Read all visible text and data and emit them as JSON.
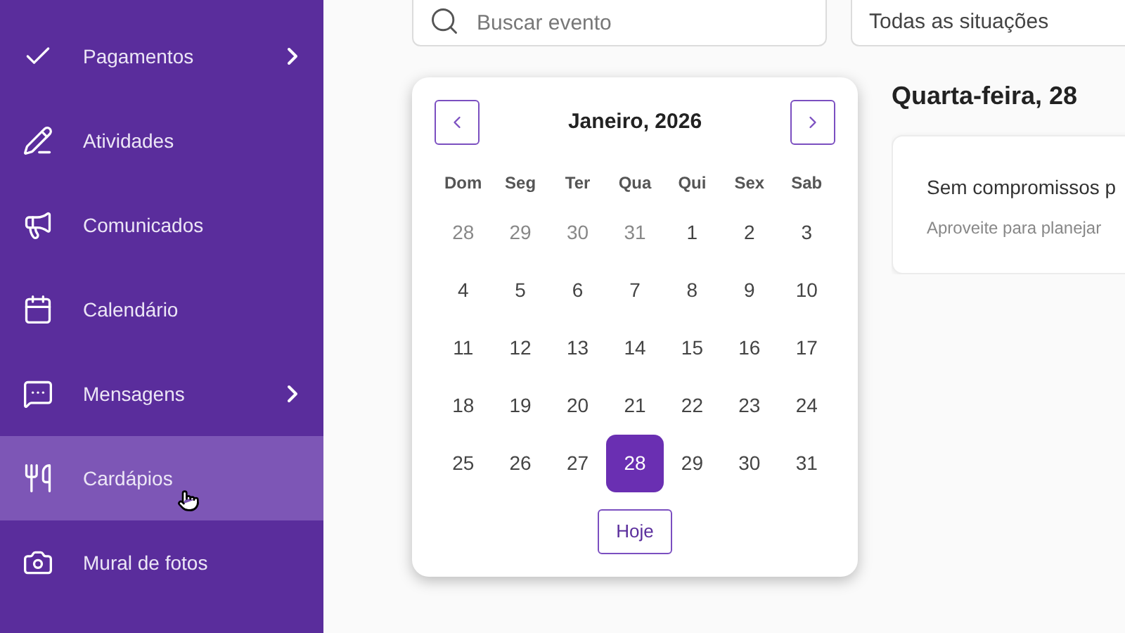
{
  "sidebar": {
    "items": [
      {
        "label": "Pagamentos",
        "has_submenu": true,
        "hovered": false
      },
      {
        "label": "Atividades",
        "has_submenu": false,
        "hovered": false
      },
      {
        "label": "Comunicados",
        "has_submenu": false,
        "hovered": false
      },
      {
        "label": "Calendário",
        "has_submenu": false,
        "hovered": false
      },
      {
        "label": "Mensagens",
        "has_submenu": true,
        "hovered": false
      },
      {
        "label": "Cardápios",
        "has_submenu": false,
        "hovered": true
      },
      {
        "label": "Mural de fotos",
        "has_submenu": false,
        "hovered": false
      }
    ]
  },
  "search": {
    "placeholder": "Buscar evento"
  },
  "status_filter": {
    "value": "Todas as situações"
  },
  "calendar": {
    "month": "Janeiro, 2026",
    "weekdays": [
      "Dom",
      "Seg",
      "Ter",
      "Qua",
      "Qui",
      "Sex",
      "Sab"
    ],
    "days": [
      {
        "label": "28",
        "muted": true,
        "selected": false
      },
      {
        "label": "29",
        "muted": true,
        "selected": false
      },
      {
        "label": "30",
        "muted": true,
        "selected": false
      },
      {
        "label": "31",
        "muted": true,
        "selected": false
      },
      {
        "label": "1",
        "muted": false,
        "selected": false
      },
      {
        "label": "2",
        "muted": false,
        "selected": false
      },
      {
        "label": "3",
        "muted": false,
        "selected": false
      },
      {
        "label": "4",
        "muted": false,
        "selected": false
      },
      {
        "label": "5",
        "muted": false,
        "selected": false
      },
      {
        "label": "6",
        "muted": false,
        "selected": false
      },
      {
        "label": "7",
        "muted": false,
        "selected": false
      },
      {
        "label": "8",
        "muted": false,
        "selected": false
      },
      {
        "label": "9",
        "muted": false,
        "selected": false
      },
      {
        "label": "10",
        "muted": false,
        "selected": false
      },
      {
        "label": "11",
        "muted": false,
        "selected": false
      },
      {
        "label": "12",
        "muted": false,
        "selected": false
      },
      {
        "label": "13",
        "muted": false,
        "selected": false
      },
      {
        "label": "14",
        "muted": false,
        "selected": false
      },
      {
        "label": "15",
        "muted": false,
        "selected": false
      },
      {
        "label": "16",
        "muted": false,
        "selected": false
      },
      {
        "label": "17",
        "muted": false,
        "selected": false
      },
      {
        "label": "18",
        "muted": false,
        "selected": false
      },
      {
        "label": "19",
        "muted": false,
        "selected": false
      },
      {
        "label": "20",
        "muted": false,
        "selected": false
      },
      {
        "label": "21",
        "muted": false,
        "selected": false
      },
      {
        "label": "22",
        "muted": false,
        "selected": false
      },
      {
        "label": "23",
        "muted": false,
        "selected": false
      },
      {
        "label": "24",
        "muted": false,
        "selected": false
      },
      {
        "label": "25",
        "muted": false,
        "selected": false
      },
      {
        "label": "26",
        "muted": false,
        "selected": false
      },
      {
        "label": "27",
        "muted": false,
        "selected": false
      },
      {
        "label": "28",
        "muted": false,
        "selected": true
      },
      {
        "label": "29",
        "muted": false,
        "selected": false
      },
      {
        "label": "30",
        "muted": false,
        "selected": false
      },
      {
        "label": "31",
        "muted": false,
        "selected": false
      }
    ],
    "today_button": "Hoje"
  },
  "day_panel": {
    "heading": "Quarta-feira, 28",
    "empty_title": "Sem compromissos p",
    "empty_text": "Aproveite para planejar"
  }
}
